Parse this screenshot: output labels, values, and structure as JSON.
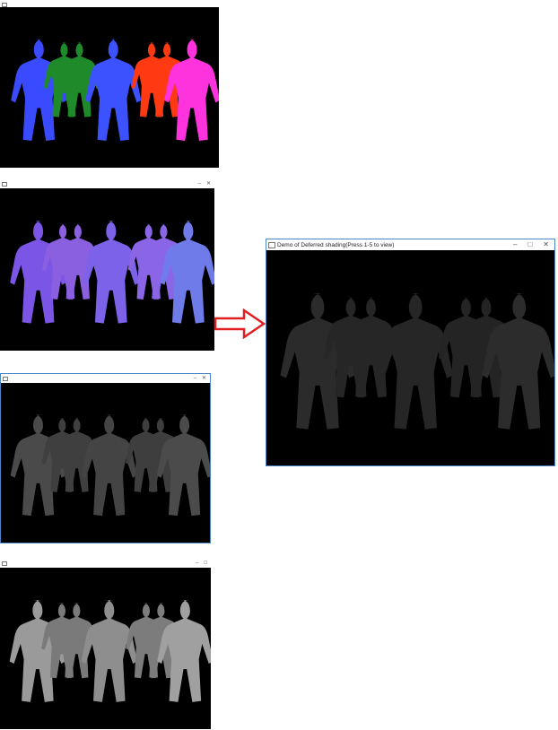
{
  "main_window": {
    "title": "Demo of Deferred shading(Press 1-5 to view)",
    "minimize_glyph": "–",
    "maximize_glyph": "□",
    "close_glyph": "✕"
  },
  "window_1": {
    "title": ""
  },
  "window_2": {
    "title": ""
  },
  "window_3": {
    "title": ""
  },
  "window_4": {
    "title": ""
  },
  "icons": {
    "arrow": "right-arrow-icon"
  },
  "colors": {
    "arrow": "#e02020",
    "window_border": "#4a86c8",
    "viewport_bg": "#000000"
  }
}
